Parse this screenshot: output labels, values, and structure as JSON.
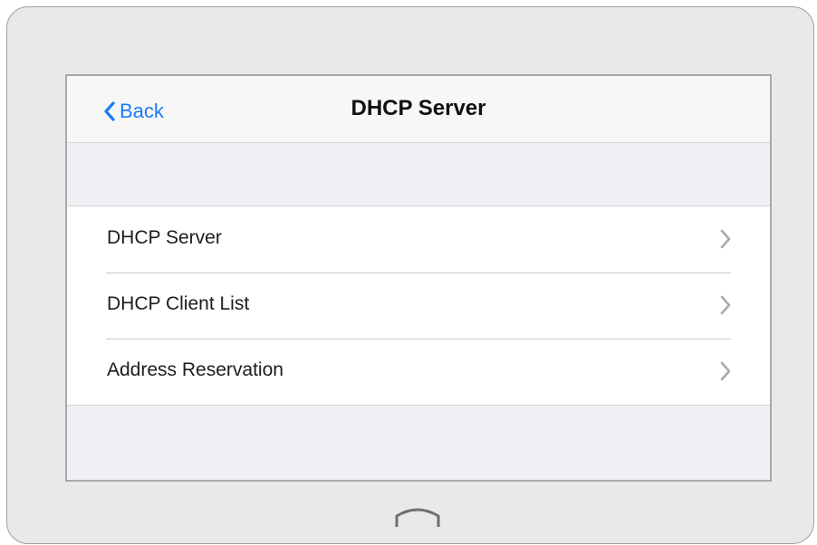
{
  "nav": {
    "back_label": "Back",
    "title": "DHCP Server"
  },
  "menu": {
    "items": [
      {
        "label": "DHCP Server",
        "icon": "chevron-right-icon"
      },
      {
        "label": "DHCP Client List",
        "icon": "chevron-right-icon"
      },
      {
        "label": "Address Reservation",
        "icon": "chevron-right-icon"
      }
    ]
  },
  "colors": {
    "accent": "#1a7cf4",
    "device_frame": "#e9e9e9",
    "group_background": "#efeff4",
    "chevron": "#a9a9ae"
  },
  "hardware": {
    "home_button_icon": "home-button-icon"
  }
}
